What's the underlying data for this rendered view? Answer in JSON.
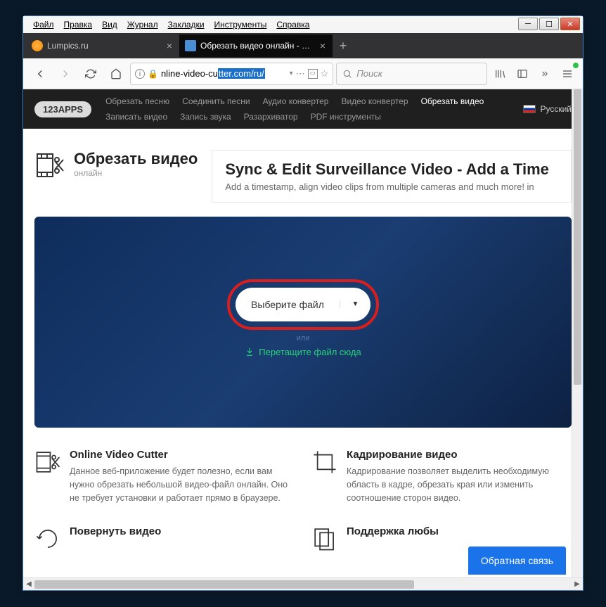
{
  "menubar": [
    "Файл",
    "Правка",
    "Вид",
    "Журнал",
    "Закладки",
    "Инструменты",
    "Справка"
  ],
  "tabs": [
    {
      "title": "Lumpics.ru"
    },
    {
      "title": "Обрезать видео онлайн - обр"
    }
  ],
  "url": {
    "prefix": "nline-video-cu",
    "selected": "tter.com/ru/"
  },
  "search": {
    "placeholder": "Поиск"
  },
  "sitenav": {
    "logo": "123APPS",
    "links": [
      "Обрезать песню",
      "Соединить песни",
      "Аудио конвертер",
      "Видео конвертер",
      "Обрезать видео",
      "Записать видео",
      "Запись звука",
      "Разархиватор",
      "PDF инструменты"
    ],
    "active_index": 4,
    "language": "Русский"
  },
  "page": {
    "title": "Обрезать видео",
    "subtitle": "онлайн"
  },
  "ad": {
    "title": "Sync & Edit Surveillance Video - Add a Time",
    "subtitle": "Add a timestamp, align video clips from multiple cameras and much more! in"
  },
  "dropzone": {
    "button": "Выберите файл",
    "or": "или",
    "drag": "Перетащите файл сюда"
  },
  "features": [
    {
      "title": "Online Video Cutter",
      "desc": "Данное веб-приложение будет полезно, если вам нужно обрезать небольшой видео-файл онлайн. Оно не требует установки и работает прямо в браузере."
    },
    {
      "title": "Кадрирование видео",
      "desc": "Кадрирование позволяет выделить необходимую область в кадре, обрезать края или изменить соотношение сторон видео."
    },
    {
      "title": "Повернуть видео",
      "desc": ""
    },
    {
      "title": "Поддержка любы",
      "desc": ""
    }
  ],
  "feedback": "Обратная связь"
}
